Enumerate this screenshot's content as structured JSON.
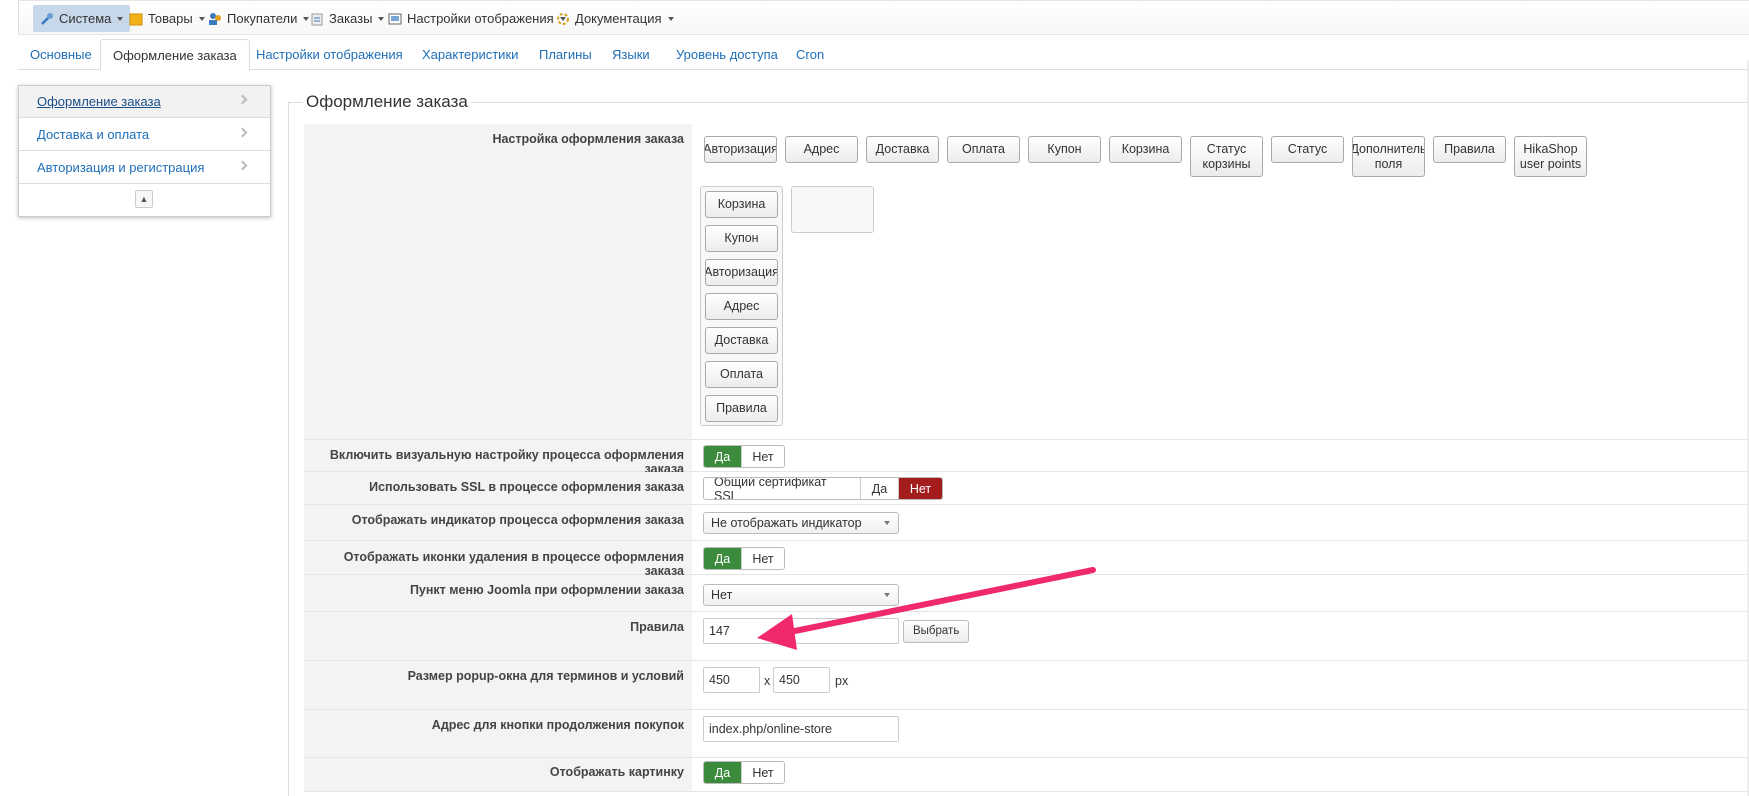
{
  "top_menu": [
    {
      "label": "Система",
      "icon": "tools-icon"
    },
    {
      "label": "Товары",
      "icon": "box-icon"
    },
    {
      "label": "Покупатели",
      "icon": "users-icon"
    },
    {
      "label": "Заказы",
      "icon": "orders-icon"
    },
    {
      "label": "Настройки отображения",
      "icon": "display-icon"
    },
    {
      "label": "Документация",
      "icon": "docs-icon"
    }
  ],
  "tabs": [
    "Основные",
    "Оформление заказа",
    "Настройки отображения",
    "Характеристики",
    "Плагины",
    "Языки",
    "Уровень доступа",
    "Cron"
  ],
  "sidebar": {
    "items": [
      "Оформление заказа",
      "Доставка и оплата",
      "Авторизация и регистрация"
    ]
  },
  "section_title": "Оформление заказа",
  "workflow": {
    "label": "Настройка оформления заказа",
    "available": [
      "Авторизация",
      "Адрес",
      "Доставка",
      "Оплата",
      "Купон",
      "Корзина",
      "Статус корзины",
      "Статус",
      "Дополнитель поля",
      "Правила",
      "HikaShop user points"
    ],
    "selected": [
      "Корзина",
      "Купон",
      "Авторизация",
      "Адрес",
      "Доставка",
      "Оплата",
      "Правила"
    ]
  },
  "settings": {
    "visual_label": "Включить визуальную настройку процесса оформления заказа",
    "visual_yes": "Да",
    "visual_no": "Нет",
    "ssl_label": "Использовать SSL в процессе оформления заказа",
    "ssl_shared": "Общий сертификат SSL",
    "ssl_yes": "Да",
    "ssl_no": "Нет",
    "indicator_label": "Отображать индикатор процесса оформления заказа",
    "indicator_value": "Не отображать индикатор",
    "delete_icons_label": "Отображать иконки удаления в процессе оформления заказа",
    "delete_yes": "Да",
    "delete_no": "Нет",
    "menu_item_label": "Пункт меню Joomla при оформлении заказа",
    "menu_item_value": "Нет",
    "rules_label": "Правила",
    "rules_value": "147",
    "rules_button": "Выбрать",
    "popup_label": "Размер popup-окна для терминов и условий",
    "popup_width": "450",
    "popup_x": "x",
    "popup_height": "450",
    "popup_unit": "px",
    "continue_label": "Адрес для кнопки продолжения покупок",
    "continue_value": "index.php/online-store",
    "image_label": "Отображать картинку",
    "image_yes": "Да",
    "image_no": "Нет"
  },
  "colors": {
    "accent_green": "#3c8a3c",
    "accent_red": "#a31d1d",
    "link_blue": "#1f6fb8",
    "arrow_pink": "#f0286e"
  }
}
